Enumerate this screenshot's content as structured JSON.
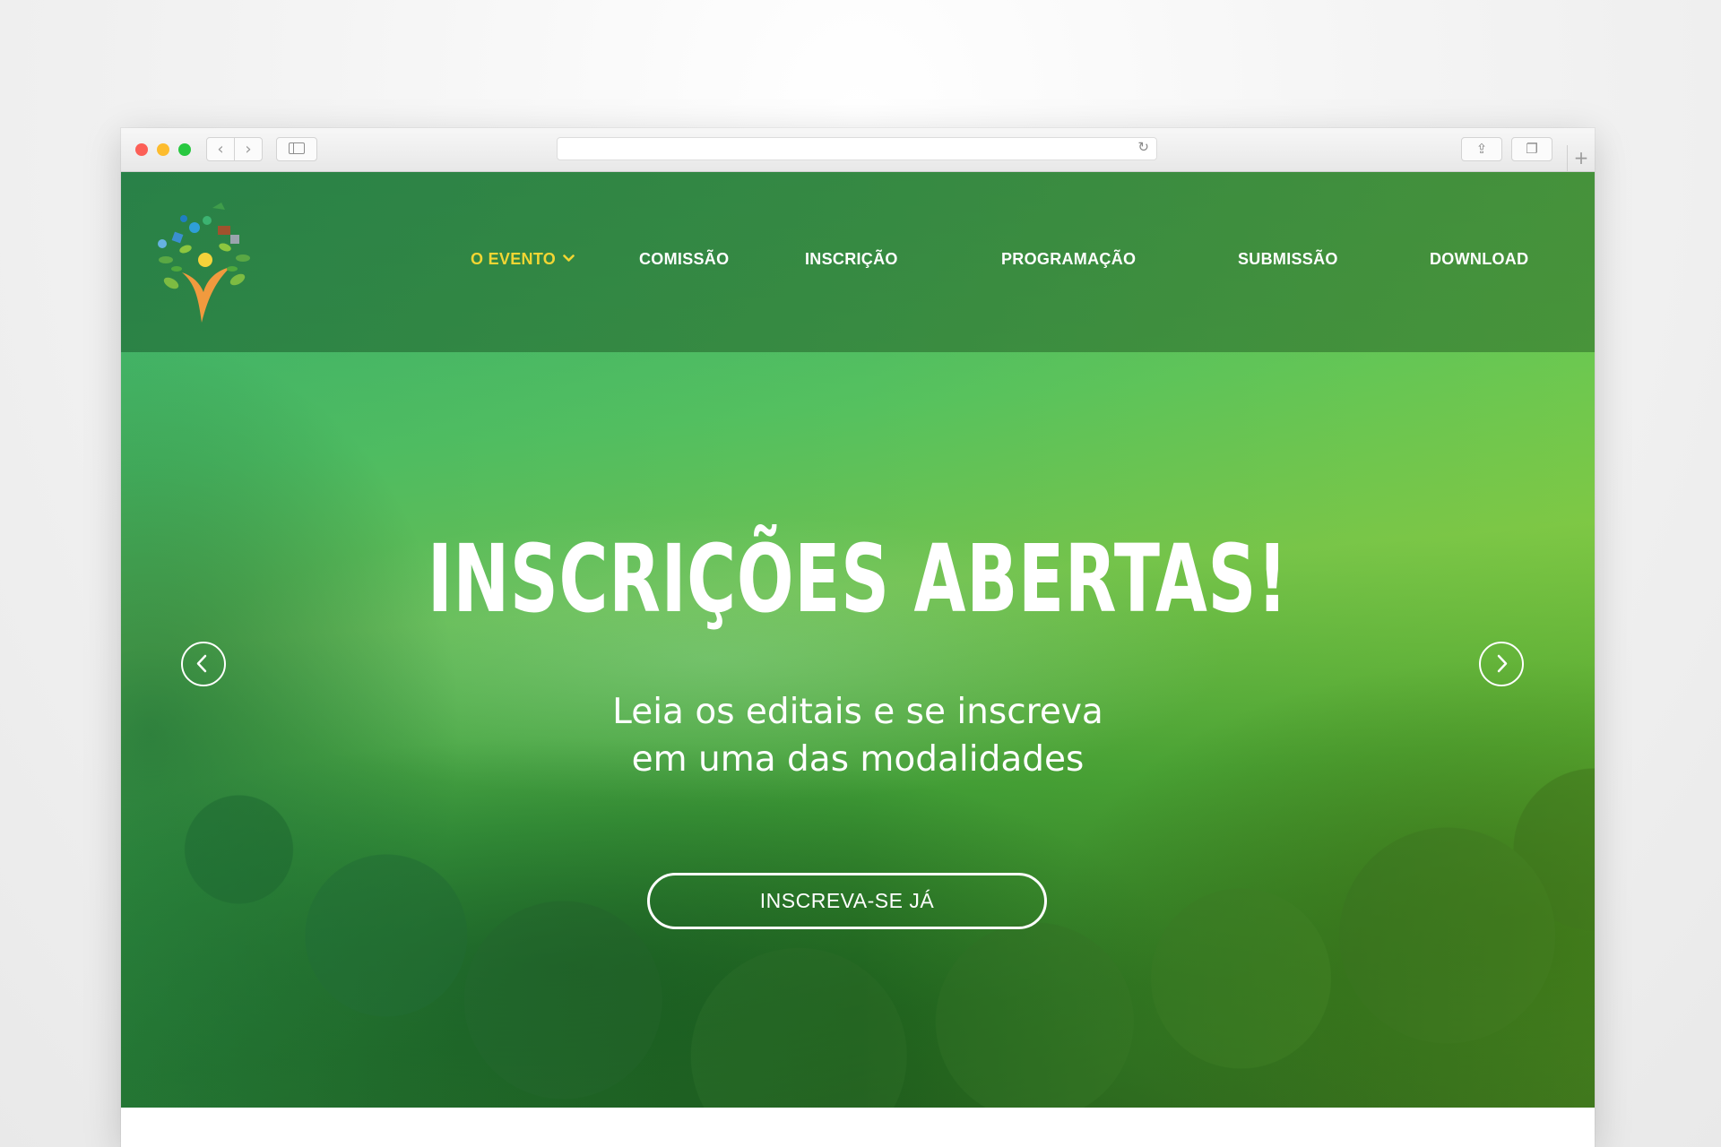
{
  "browser": {
    "back_glyph": "‹",
    "forward_glyph": "›",
    "reload_glyph": "↻",
    "share_glyph": "⇪",
    "tabs_glyph": "❐",
    "newtab_glyph": "+"
  },
  "header": {
    "nav": [
      {
        "label": "O EVENTO",
        "active": true
      },
      {
        "label": "COMISSÃO"
      },
      {
        "label": "INSCRIÇÃO"
      },
      {
        "label": "PROGRAMAÇÃO"
      },
      {
        "label": "SUBMISSÃO"
      },
      {
        "label": "DOWNLOAD"
      }
    ]
  },
  "hero": {
    "title": "INSCRIÇÕES ABERTAS!",
    "subtitle_line1": "Leia os editais e se inscreva",
    "subtitle_line2": "em uma das modalidades",
    "cta_label": "INSCREVA-SE JÁ"
  },
  "colors": {
    "active_nav": "#f2d633",
    "header_overlay": "#22703a",
    "text": "#ffffff"
  }
}
